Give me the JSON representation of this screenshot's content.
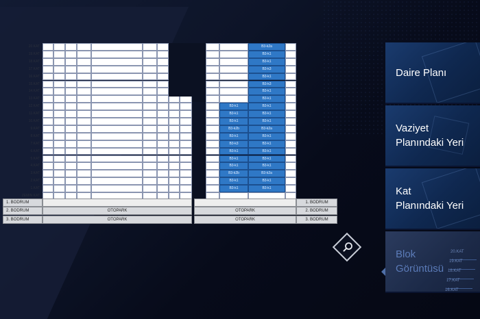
{
  "floors": [
    "20.KAT",
    "19.KAT",
    "18.KAT",
    "17.KAT",
    "16.KAT",
    "15.KAT",
    "14.KAT",
    "13.KAT",
    "12.KAT",
    "11.KAT",
    "10.KAT",
    "9.KAT",
    "8.KAT",
    "7.KAT",
    "6.KAT",
    "5.KAT",
    "4.KAT",
    "3.KAT",
    "2.KAT",
    "1.KAT",
    "ZEMIN KAT"
  ],
  "blue_col_b": [
    "B3-k2a",
    "B3-k1",
    "B3-k1",
    "B3-k3",
    "B3-k1",
    "B3-k3",
    "B3-k1",
    "B3-k1",
    "B3-k1",
    "B3-k1",
    "B3-k1",
    "B3-k2a",
    "B3-k1",
    "B3-k1",
    "B3-k1",
    "B3-k1",
    "B3-k1",
    "B3-k2a",
    "B3-k1",
    "B3-k1",
    ""
  ],
  "blue_col_a": [
    "",
    "",
    "",
    "",
    "",
    "",
    "",
    "",
    "B3-k1",
    "B3-k1",
    "B3-k1",
    "B3-k2b",
    "B3-k1",
    "B3-k3",
    "B3-k1",
    "B3-k1",
    "B3-k1",
    "B3-k2b",
    "B3-k1",
    "B3-k1",
    ""
  ],
  "basement": {
    "rows": [
      {
        "label": "1. BODRUM",
        "center": "",
        "right_label": "1. BODRUM"
      },
      {
        "label": "2. BODRUM",
        "center": "OTOPARK",
        "right_center": "OTOPARK",
        "right_label": "2. BODRUM"
      },
      {
        "label": "3. BODRUM",
        "center": "OTOPARK",
        "right_center": "OTOPARK",
        "right_label": "3. BODRUM"
      }
    ]
  },
  "menu": {
    "items": [
      {
        "label_1": "Daire Planı",
        "label_2": ""
      },
      {
        "label_1": "Vaziyet",
        "label_2": "Planındaki Yeri"
      },
      {
        "label_1": "Kat",
        "label_2": "Planındaki Yeri"
      },
      {
        "label_1": "Blok",
        "label_2": "Görüntüsü"
      }
    ]
  },
  "mini_floors": [
    "20.KAT",
    "19.KAT",
    "18.KAT",
    "17.KAT",
    "16.KAT"
  ],
  "icons": {
    "zoom": "magnifier-icon",
    "pointer": "triangle-left-icon"
  },
  "colors": {
    "unit_blue": "#2f78c6",
    "menu_active_text": "#5b7bb8"
  }
}
